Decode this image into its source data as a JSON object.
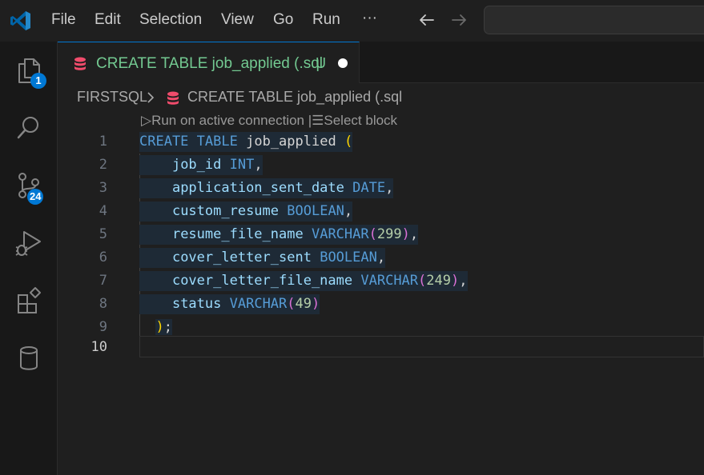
{
  "menu": {
    "file": "File",
    "edit": "Edit",
    "selection": "Selection",
    "view": "View",
    "go": "Go",
    "run": "Run",
    "more": "···"
  },
  "activity": {
    "explorer_badge": "1",
    "scm_badge": "24"
  },
  "tab": {
    "label": "CREATE TABLE job_applied (.sql",
    "status": "U"
  },
  "breadcrumb": {
    "root": "FIRSTSQL",
    "file": "CREATE TABLE job_applied (.sql"
  },
  "codelens": {
    "run": "Run on active connection",
    "separator": "|",
    "select": "Select block"
  },
  "editor": {
    "line_numbers": [
      "1",
      "2",
      "3",
      "4",
      "5",
      "6",
      "7",
      "8",
      "9",
      "10"
    ],
    "lines": [
      {
        "ident": "job_applied",
        "open": "("
      },
      {
        "col": "job_id",
        "type": "INT",
        "comma": ","
      },
      {
        "col": "application_sent_date",
        "type": "DATE",
        "comma": ","
      },
      {
        "col": "custom_resume",
        "type": "BOOLEAN",
        "comma": ","
      },
      {
        "col": "resume_file_name",
        "type": "VARCHAR",
        "lp": "(",
        "len": "299",
        "rp": ")",
        "comma": ","
      },
      {
        "col": "cover_letter_sent",
        "type": "BOOLEAN",
        "comma": ","
      },
      {
        "col": "cover_letter_file_name",
        "type": "VARCHAR",
        "lp": "(",
        "len": "249",
        "rp": ")",
        "comma": ","
      },
      {
        "col": "status",
        "type": "VARCHAR",
        "lp": "(",
        "len": "49",
        "rp": ")"
      },
      {
        "close": ")",
        "semi": ";"
      }
    ],
    "kw_create": "CREATE",
    "kw_table": "TABLE"
  },
  "colors": {
    "accent": "#0078d4",
    "untracked": "#73c991",
    "keyword": "#569cd6",
    "identifier": "#9cdcfe",
    "number": "#b5cea8",
    "bracket_1": "#ffd700",
    "bracket_2": "#da70d6"
  },
  "icons": {
    "logo": "vscode-logo-icon",
    "explorer": "files-icon",
    "search": "search-icon",
    "scm": "source-control-icon",
    "debug": "run-debug-icon",
    "extensions": "extensions-icon",
    "database": "database-icon",
    "back": "arrow-left-icon",
    "forward": "arrow-right-icon"
  }
}
